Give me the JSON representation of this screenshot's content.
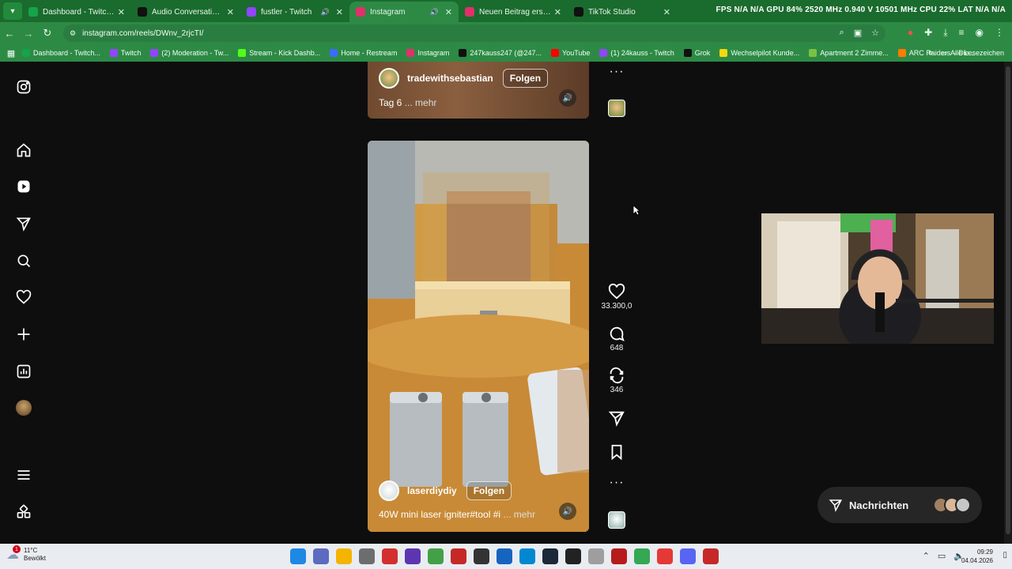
{
  "browser": {
    "tabs": [
      {
        "label": "Dashboard - TwitchTTS",
        "favicon_color": "#16a34a",
        "sound": false,
        "active": false
      },
      {
        "label": "Audio Conversation - Gro",
        "favicon_color": "#111111",
        "sound": false,
        "active": false
      },
      {
        "label": "fustler - Twitch",
        "favicon_color": "#9146ff",
        "sound": true,
        "active": false
      },
      {
        "label": "Instagram",
        "favicon_color": "#e1306c",
        "sound": true,
        "active": true
      },
      {
        "label": "Neuen Beitrag erstellen -",
        "favicon_color": "#e1306c",
        "sound": false,
        "active": false
      },
      {
        "label": "TikTok Studio",
        "favicon_color": "#111111",
        "sound": false,
        "active": false
      }
    ],
    "overlay_stats": "FPS N/A N/A GPU 84% 2520 MHz 0.940 V 10501 MHz CPU 22% LAT N/A N/A",
    "url": "instagram.com/reels/DWnv_2rjcTI/",
    "bookmarks": [
      {
        "label": "Dashboard - Twitch...",
        "color": "#16a34a"
      },
      {
        "label": "Twitch",
        "color": "#9146ff"
      },
      {
        "label": "(2) Moderation - Tw...",
        "color": "#9146ff"
      },
      {
        "label": "Stream - Kick Dashb...",
        "color": "#53fc18"
      },
      {
        "label": "Home - Restream",
        "color": "#3b6cff"
      },
      {
        "label": "Instagram",
        "color": "#e1306c"
      },
      {
        "label": "247kauss247 (@247...",
        "color": "#111111"
      },
      {
        "label": "YouTube",
        "color": "#ff0000"
      },
      {
        "label": "(1) 24kauss - Twitch",
        "color": "#9146ff"
      },
      {
        "label": "Grok",
        "color": "#111111"
      },
      {
        "label": "Wechselpilot Kunde...",
        "color": "#f5d90a"
      },
      {
        "label": "Apartment 2 Zimme...",
        "color": "#7ac143"
      },
      {
        "label": "ARC Raiders – Die...",
        "color": "#ff7a00"
      }
    ],
    "bookmarks_more": "»",
    "all_bookmarks": "Alle Lesezeichen"
  },
  "reel_top": {
    "author": "tradewithsebastian",
    "follow": "Folgen",
    "caption": "Tag 6",
    "more": "... mehr"
  },
  "reel_main": {
    "author": "laserdiydiy",
    "follow": "Folgen",
    "caption": "40W mini laser igniter#tool #i",
    "more": "... mehr"
  },
  "actions": {
    "likes": "33.300,0",
    "comments": "648",
    "reposts": "346"
  },
  "messages": {
    "label": "Nachrichten"
  },
  "taskbar": {
    "temp": "11°C",
    "weather": "Bewölkt",
    "time": "09:29",
    "date": "04.04.2026",
    "notification_count": "1"
  }
}
